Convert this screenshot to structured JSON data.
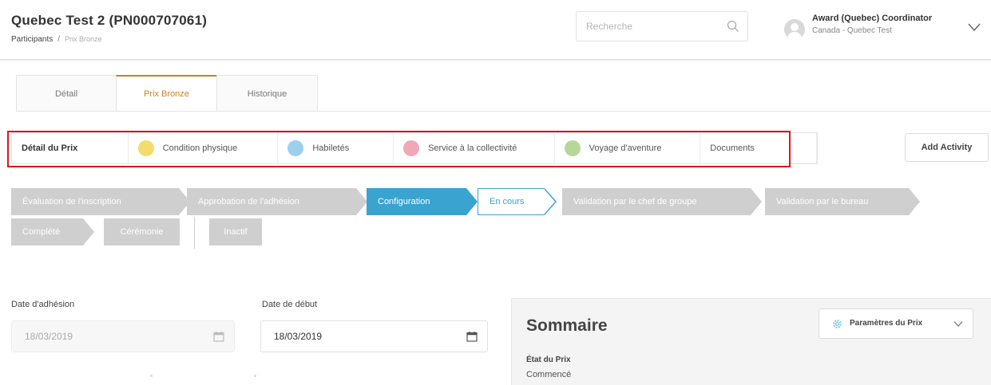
{
  "header": {
    "title": "Quebec Test 2 (PN000707061)",
    "breadcrumb": {
      "parent": "Participants",
      "separator": "/",
      "current": "Prix Bronze"
    },
    "search": {
      "placeholder": "Recherche",
      "icon": "search-icon"
    },
    "user": {
      "name": "Award (Quebec) Coordinator",
      "org": "Canada - Quebec Test",
      "icon": "chevron-down-icon"
    }
  },
  "main_tabs": [
    {
      "label": "Détail",
      "active": false
    },
    {
      "label": "Prix Bronze",
      "active": true
    },
    {
      "label": "Historique",
      "active": false
    }
  ],
  "sub_tabs": [
    {
      "label": "Détail du Prix",
      "active": true,
      "icon": "",
      "color": ""
    },
    {
      "label": "Condition physique",
      "active": false,
      "icon": "physical-recreation-icon",
      "color": "#f2dc6c"
    },
    {
      "label": "Habiletés",
      "active": false,
      "icon": "skills-icon",
      "color": "#9dd0ee"
    },
    {
      "label": "Service à la collectivité",
      "active": false,
      "icon": "volunteering-icon",
      "color": "#f0a8b4"
    },
    {
      "label": "Voyage d'aventure",
      "active": false,
      "icon": "adventurous-journey-icon",
      "color": "#b7d79a"
    },
    {
      "label": "Documents",
      "active": false,
      "icon": "",
      "color": ""
    }
  ],
  "add_activity_label": "Add Activity",
  "status_steps": [
    {
      "label": "Évaluation de l'inscription",
      "state": "inactive"
    },
    {
      "label": "Approbation de l'adhésion",
      "state": "inactive"
    },
    {
      "label": "Configuration",
      "state": "active"
    },
    {
      "label": "En cours",
      "state": "current"
    },
    {
      "label": "Validation par le chef de groupe",
      "state": "inactive"
    },
    {
      "label": "Validation par le bureau",
      "state": "inactive"
    },
    {
      "label": "Complété",
      "state": "inactive"
    },
    {
      "label": "Cérémonie",
      "state": "inactive"
    },
    {
      "label": "Inactif",
      "state": "inactive"
    }
  ],
  "form": {
    "adhesion": {
      "label": "Date d'adhésion",
      "value": "18/03/2019",
      "disabled": true,
      "icon": "calendar-icon"
    },
    "debut": {
      "label": "Date de début",
      "value": "18/03/2019",
      "disabled": false,
      "icon": "calendar-icon"
    }
  },
  "summary": {
    "title": "Sommaire",
    "settings_label": "Paramètres du Prix",
    "state_label": "État du Prix",
    "state_value": "Commencé"
  },
  "colors": {
    "accent_blue": "#3aa3d0",
    "tab_active": "#c8821e",
    "highlight_red": "#e0141b",
    "step_inactive": "#cfcfcf"
  }
}
